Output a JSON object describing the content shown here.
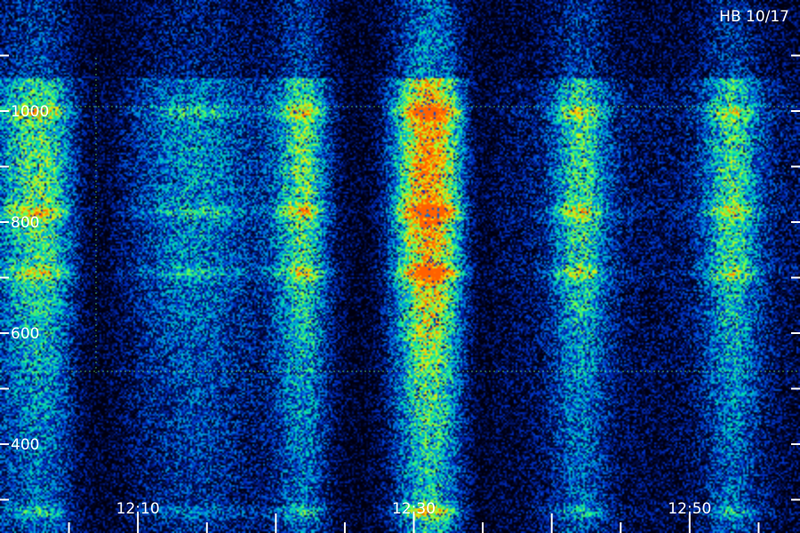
{
  "chart_data": {
    "type": "heatmap",
    "title": "HB 10/17",
    "xlabel": "",
    "ylabel": "",
    "x_tick_labels": [
      "12:10",
      "12:30",
      "12:50"
    ],
    "y_tick_labels": [
      "400",
      "600",
      "800",
      "1000"
    ],
    "xlim": [
      "12:00",
      "12:58"
    ],
    "ylim": [
      240,
      1200
    ],
    "colormap": [
      "#000010",
      "#00105a",
      "#0030c8",
      "#0090e0",
      "#00e0b0",
      "#80ff40",
      "#ffe000",
      "#ff6000"
    ],
    "bright_time_bands": [
      {
        "center": "12:03",
        "width_min": 5,
        "intensity": 0.55
      },
      {
        "center": "12:14",
        "width_min": 6,
        "intensity": 0.32
      },
      {
        "center": "12:22",
        "width_min": 3,
        "intensity": 0.55
      },
      {
        "center": "12:31",
        "width_min": 4,
        "intensity": 0.85
      },
      {
        "center": "12:42",
        "width_min": 3,
        "intensity": 0.5
      },
      {
        "center": "12:53",
        "width_min": 3,
        "intensity": 0.5
      }
    ],
    "dark_time_bands": [
      {
        "center": "12:07",
        "width_min": 3
      },
      {
        "center": "12:26",
        "width_min": 3
      },
      {
        "center": "12:35",
        "width_min": 2
      }
    ],
    "bright_frequency_lines": [
      280,
      710,
      820,
      1000
    ],
    "dashed_frequency_lines": [
      1000,
      500
    ]
  }
}
